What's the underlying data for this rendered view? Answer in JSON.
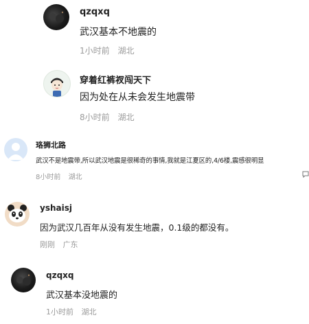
{
  "comments": [
    {
      "username": "qzqxq",
      "text": "武汉基本不地震的",
      "time": "1小时前",
      "location": "湖北",
      "avatar_icon": "dark-night-photo-avatar-icon"
    },
    {
      "username": "穿着红裤衩闯天下",
      "text": "因为处在从未会发生地震带",
      "time": "8小时前",
      "location": "湖北",
      "avatar_icon": "cartoon-boy-avatar-icon"
    },
    {
      "username": "珞狮北路",
      "text": "武汉不是地震带,所以武汉地震是很稀奇的事情,我就是江夏区的,4/6楼,震感很明显",
      "time": "8小时前",
      "location": "湖北",
      "avatar_icon": "default-user-avatar-icon",
      "reply_icon": "reply-icon"
    },
    {
      "username": "yshaisj",
      "text": "因为武汉几百年从没有发生地震，0.1级的都没有。",
      "time": "刚刚",
      "location": "广东",
      "avatar_icon": "panda-face-avatar-icon"
    },
    {
      "username": "qzqxq",
      "text": "武汉基本没地震的",
      "time": "1小时前",
      "location": "湖北",
      "avatar_icon": "dark-night-photo-avatar-icon"
    }
  ]
}
